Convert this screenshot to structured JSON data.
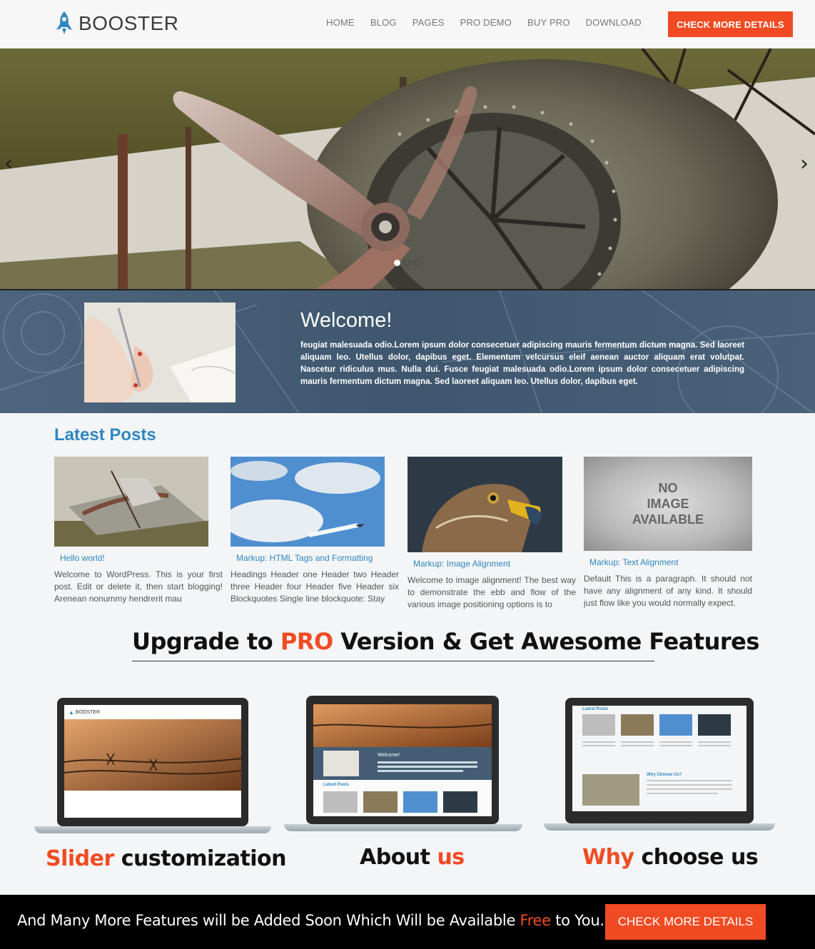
{
  "header": {
    "logo_text": "BOOSTER",
    "nav": [
      "HOME",
      "BLOG",
      "PAGES",
      "PRO DEMO",
      "BUY PRO",
      "DOWNLOAD"
    ],
    "cta_label": "CHECK MORE DETAILS"
  },
  "slider": {
    "prev_icon": "‹",
    "next_icon": "›",
    "slide_count": 3,
    "active_slide": 1
  },
  "welcome": {
    "title": "Welcome!",
    "text": "feugiat malesuada odio.Lorem ipsum dolor consecetuer adipiscing mauris fermentum dictum magna. Sed laoreet aliquam leo. Utellus dolor, dapibus eget. Elementum velcursus eleif aenean auctor aliquam erat volutpat. Nascetur ridiculus mus. Nulla dui. Fusce feugiat malesuada odio.Lorem ipsum dolor consecetuer adipiscing mauris fermentum dictum magna. Sed laoreet aliquam leo. Utellus dolor, dapibus eget."
  },
  "latest_posts": {
    "heading": "Latest Posts",
    "posts": [
      {
        "title": "Hello world!",
        "excerpt": "Welcome to WordPress. This is your first post. Edit or delete it, then start blogging! Arenean nonummy hendrerit mau"
      },
      {
        "title": "Markup: HTML Tags and Formatting",
        "excerpt": "Headings Header one Header two Header three Header four Header five Header six Blockquotes Single line blockquote: Stay"
      },
      {
        "title": "Markup: Image Alignment",
        "excerpt": "Welcome to image alignment! The best way to demonstrate the ebb and flow of the various image positioning options is to"
      },
      {
        "title": "Markup: Text Alignment",
        "excerpt": "Default This is a paragraph. It should not have any alignment of any kind. It should just flow like you would normally expect."
      }
    ],
    "no_image_label": [
      "NO",
      "IMAGE",
      "AVAILABLE"
    ]
  },
  "upgrade": {
    "heading_pre": "Upgrade to ",
    "heading_hl": "PRO",
    "heading_post": " Version & Get Awesome Features"
  },
  "features": [
    {
      "hl": "Slider",
      "rest": " customization",
      "hl_first": true
    },
    {
      "hl": "us",
      "rest": "About ",
      "hl_first": false
    },
    {
      "hl": "Why",
      "rest": " choose us",
      "hl_first": true
    }
  ],
  "mini_screens": {
    "logo": "BOOSTER",
    "welcome": "Welcome!",
    "latest": "Latest Posts",
    "why": "Why Choose Us?"
  },
  "footer": {
    "text_pre": "And Many More Features will be Added Soon Which Will be Available ",
    "text_hl": "Free",
    "text_post": " to You.",
    "cta_label": "CHECK MORE DETAILS"
  },
  "colors": {
    "accent": "#f04b23",
    "link": "#2f87c0",
    "band": "#445d74"
  }
}
